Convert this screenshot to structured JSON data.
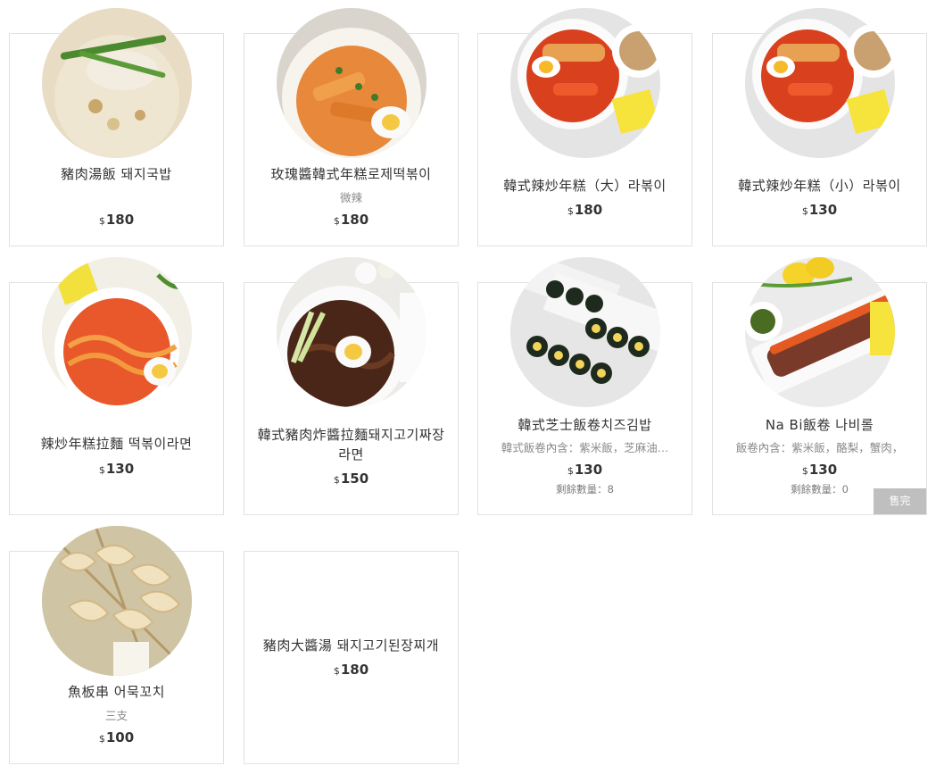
{
  "currency_symbol": "$",
  "items": [
    {
      "name": "豬肉湯飯 돼지국밥",
      "price": "180",
      "photo": "pork-soup-rice-photo"
    },
    {
      "name": "玫瑰醬韓式年糕로제떡볶이",
      "note": "微辣",
      "price": "180",
      "photo": "rose-tteokbokki-photo"
    },
    {
      "name": "韓式辣炒年糕（大）라볶이",
      "price": "180",
      "photo": "rabokki-large-photo"
    },
    {
      "name": "韓式辣炒年糕（小）라볶이",
      "price": "130",
      "photo": "rabokki-small-photo"
    },
    {
      "name": "辣炒年糕拉麵 떡볶이라면",
      "price": "130",
      "photo": "tteokbokki-ramen-photo"
    },
    {
      "name": "韓式豬肉炸醬拉麵돼지고기짜장라면",
      "price": "150",
      "photo": "jjajang-ramen-photo"
    },
    {
      "name": "韓式芝士飯卷치즈김밥",
      "note": "韓式飯卷內含：紫米飯，芝麻油…",
      "price": "130",
      "stock": "剩餘數量：8",
      "photo": "cheese-kimbap-photo"
    },
    {
      "name": "Na Bi飯卷 나비롤",
      "note": "飯卷內含：紫米飯，酪梨，蟹肉，",
      "price": "130",
      "stock": "剩餘數量：0",
      "sold_out": "售完",
      "photo": "nabi-roll-photo"
    },
    {
      "name": "魚板串 어묵꼬치",
      "note": "三支",
      "price": "100",
      "photo": "fishcake-skewer-photo"
    },
    {
      "name": "豬肉大醬湯 돼지고기된장찌개",
      "price": "180"
    }
  ],
  "colors": {
    "border": "#e2e2e2",
    "text": "#333333",
    "muted": "#8a8a8a",
    "soldout_bg": "#bfbfbf"
  }
}
